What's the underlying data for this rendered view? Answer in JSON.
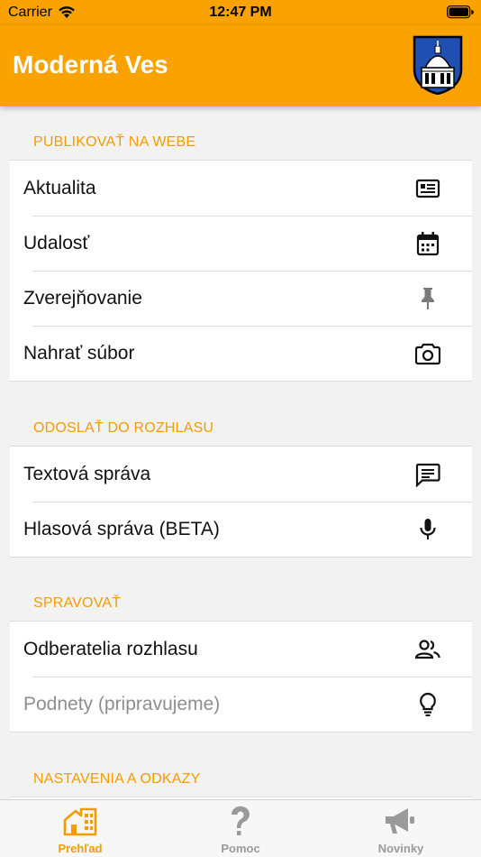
{
  "status_bar": {
    "carrier": "Carrier",
    "time": "12:47 PM",
    "wifi_icon": "wifi-icon",
    "battery_icon": "battery-icon"
  },
  "nav": {
    "title": "Moderná Ves",
    "crest_icon": "municipal-crest-icon"
  },
  "sections": [
    {
      "header": "PUBLIKOVAŤ NA WEBE",
      "items": [
        {
          "label": "Aktualita",
          "icon": "news-icon"
        },
        {
          "label": "Udalosť",
          "icon": "calendar-icon"
        },
        {
          "label": "Zverejňovanie",
          "icon": "pin-icon"
        },
        {
          "label": "Nahrať súbor",
          "icon": "camera-icon"
        }
      ]
    },
    {
      "header": "ODOSLAŤ DO ROZHLASU",
      "items": [
        {
          "label": "Textová správa",
          "icon": "message-icon"
        },
        {
          "label": "Hlasová správa (BETA)",
          "icon": "microphone-icon"
        }
      ]
    },
    {
      "header": "SPRAVOVAŤ",
      "items": [
        {
          "label": "Odberatelia rozhlasu",
          "icon": "people-icon"
        },
        {
          "label": "Podnety (pripravujeme)",
          "icon": "lightbulb-icon",
          "disabled": true
        }
      ]
    },
    {
      "header": "NASTAVENIA A ODKAZY",
      "items": []
    }
  ],
  "tabs": [
    {
      "label": "Prehľad",
      "icon": "home-icon",
      "active": true
    },
    {
      "label": "Pomoc",
      "icon": "help-icon",
      "active": false
    },
    {
      "label": "Novinky",
      "icon": "megaphone-icon",
      "active": false
    }
  ],
  "colors": {
    "accent": "#f9a200",
    "section_header": "#f29c00",
    "disabled_text": "#8e8e8e",
    "inactive_tab": "#9a9a9a"
  }
}
